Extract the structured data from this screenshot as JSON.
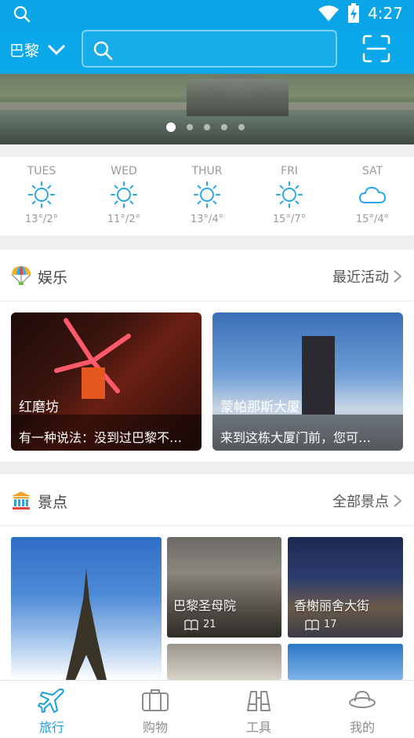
{
  "status_bar": {
    "time": "4:27"
  },
  "header": {
    "city": "巴黎",
    "search_placeholder": "",
    "accent": "#0aa7e8"
  },
  "banner": {
    "dots": 5,
    "active_dot": 1
  },
  "weather": [
    {
      "day": "TUES",
      "temp": "13°/2°",
      "icon": "sun-icon"
    },
    {
      "day": "WED",
      "temp": "11°/2°",
      "icon": "sun-icon"
    },
    {
      "day": "THUR",
      "temp": "13°/4°",
      "icon": "sun-icon"
    },
    {
      "day": "FRI",
      "temp": "15°/7°",
      "icon": "sun-icon"
    },
    {
      "day": "SAT",
      "temp": "15°/4°",
      "icon": "cloud-icon"
    }
  ],
  "entertainment": {
    "title": "娱乐",
    "more": "最近活动",
    "cards": [
      {
        "title": "红磨坊",
        "desc": "有一种说法：没到过巴黎不…"
      },
      {
        "title": "蒙帕那斯大厦",
        "desc": "来到这栋大厦门前，您可…"
      }
    ]
  },
  "attractions": {
    "title": "景点",
    "more": "全部景点",
    "items": [
      {
        "name": "巴黎圣母院",
        "count": "21"
      },
      {
        "name": "香榭丽舍大街",
        "count": "17"
      }
    ]
  },
  "bottom_nav": {
    "items": [
      {
        "label": "旅行",
        "icon": "airplane-icon",
        "active": true
      },
      {
        "label": "购物",
        "icon": "suitcase-icon",
        "active": false
      },
      {
        "label": "工具",
        "icon": "binoculars-icon",
        "active": false
      },
      {
        "label": "我的",
        "icon": "hat-icon",
        "active": false
      }
    ]
  }
}
